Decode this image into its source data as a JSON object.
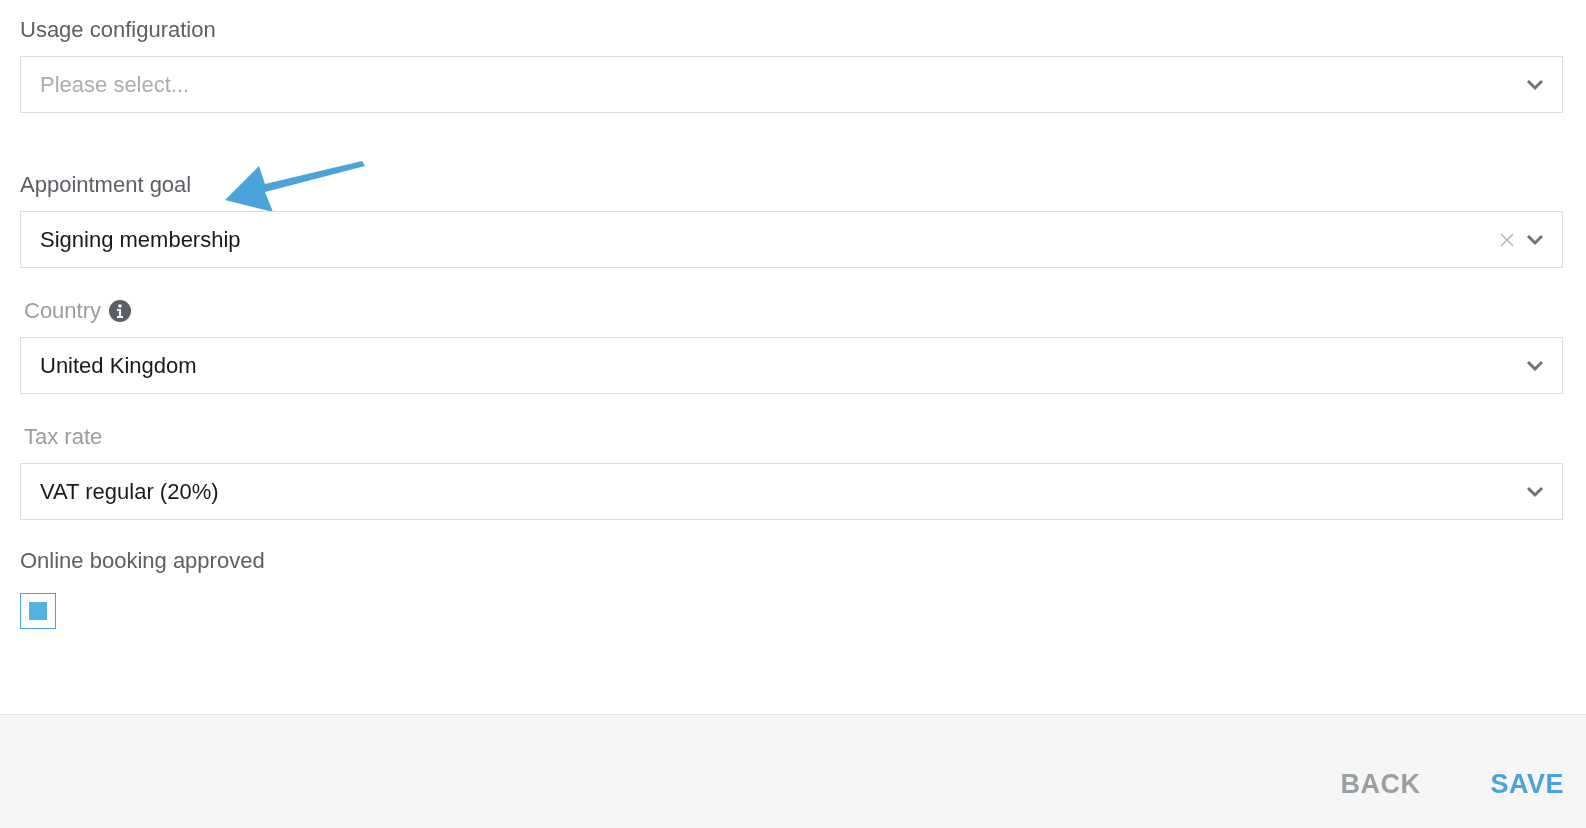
{
  "fields": [
    {
      "label": "Usage configuration",
      "placeholder": "Please select...",
      "clearable": false,
      "disabled": false,
      "info": false
    },
    {
      "label": "Appointment goal",
      "value": "Signing membership",
      "clearable": true,
      "disabled": false,
      "info": false
    },
    {
      "label": "Country",
      "value": "United Kingdom",
      "clearable": false,
      "disabled": true,
      "info": true
    },
    {
      "label": "Tax rate",
      "value": "VAT regular (20%)",
      "clearable": false,
      "disabled": true,
      "info": false
    }
  ],
  "checkbox": {
    "label": "Online booking approved",
    "checked": true
  },
  "buttons": [
    {
      "label": "BACK",
      "kind": "secondary"
    },
    {
      "label": "SAVE",
      "kind": "primary"
    }
  ]
}
